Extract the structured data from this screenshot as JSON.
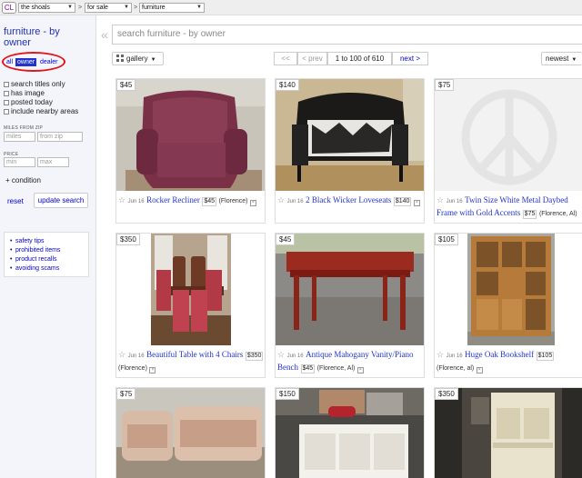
{
  "logo": "CL",
  "breadcrumb": {
    "area": "the shoals",
    "section": "for sale",
    "category": "furniture",
    "sep": ">"
  },
  "sidebar": {
    "title": "furniture - by owner",
    "seg_all": "all",
    "seg_owner": "owner",
    "seg_dealer": "dealer",
    "options": [
      "search titles only",
      "has image",
      "posted today",
      "include nearby areas"
    ],
    "miles_label": "MILES FROM ZIP",
    "miles_placeholder": "miles",
    "zip_placeholder": "from zip",
    "price_label": "PRICE",
    "min_placeholder": "min",
    "max_placeholder": "max",
    "condition": "condition",
    "reset": "reset",
    "update": "update search",
    "links": [
      "safety tips",
      "prohibited items",
      "product recalls",
      "avoiding scams"
    ]
  },
  "collapse_glyph": "«",
  "search": {
    "placeholder": "search furniture - by owner"
  },
  "toolbar": {
    "view": "gallery",
    "first": "<<",
    "prev": "< prev",
    "range": "1 to 100 of 610",
    "next": "next >",
    "sort": "newest"
  },
  "listings": [
    {
      "price": "$45",
      "date": "Jun 16",
      "title": "Rocker Recliner",
      "tag": "$45",
      "loc": "(Florence)"
    },
    {
      "price": "$140",
      "date": "Jun 16",
      "title": "2 Black Wicker Loveseats",
      "tag": "$140",
      "loc": ""
    },
    {
      "price": "$75",
      "date": "Jun 16",
      "title": "Twin Size White Metal Daybed Frame with Gold Accents",
      "tag": "$75",
      "loc": "(Florence, Al)"
    },
    {
      "price": "$350",
      "date": "Jun 16",
      "title": "Beautiful Table with 4 Chairs",
      "tag": "$350",
      "loc": "(Florence)"
    },
    {
      "price": "$45",
      "date": "Jun 16",
      "title": "Antique Mahogany Vanity/Piano Bench",
      "tag": "$45",
      "loc": "(Florence, Al)"
    },
    {
      "price": "$105",
      "date": "Jun 16",
      "title": "Huge Oak Bookshelf",
      "tag": "$105",
      "loc": "(Florence, al)"
    },
    {
      "price": "$75"
    },
    {
      "price": "$150"
    },
    {
      "price": "$350"
    }
  ],
  "colors": {
    "link": "#2233cc",
    "highlight": "#e0161b"
  }
}
